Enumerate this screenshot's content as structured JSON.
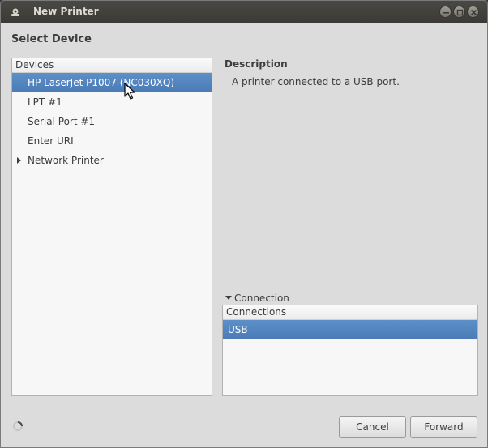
{
  "window": {
    "title": "New Printer"
  },
  "page": {
    "heading": "Select Device"
  },
  "devices": {
    "header": "Devices",
    "items": [
      {
        "label": "HP LaserJet P1007 (NC030XQ)",
        "selected": true
      },
      {
        "label": "LPT #1",
        "selected": false
      },
      {
        "label": "Serial Port #1",
        "selected": false
      },
      {
        "label": "Enter URI",
        "selected": false
      },
      {
        "label": "Network Printer",
        "selected": false,
        "expandable": true
      }
    ]
  },
  "description": {
    "heading": "Description",
    "text": "A printer connected to a USB port."
  },
  "connection": {
    "expander_label": "Connection",
    "header": "Connections",
    "items": [
      {
        "label": "USB",
        "selected": true
      }
    ]
  },
  "buttons": {
    "cancel": "Cancel",
    "forward": "Forward"
  },
  "colors": {
    "selection": "#4a7bb7",
    "titlebar": "#3b3a36",
    "background": "#dcdcdc"
  },
  "icons": {
    "app": "printer-app-icon",
    "minimize": "minimize-icon",
    "maximize": "maximize-icon",
    "close": "close-icon",
    "busy": "spinner-icon"
  }
}
